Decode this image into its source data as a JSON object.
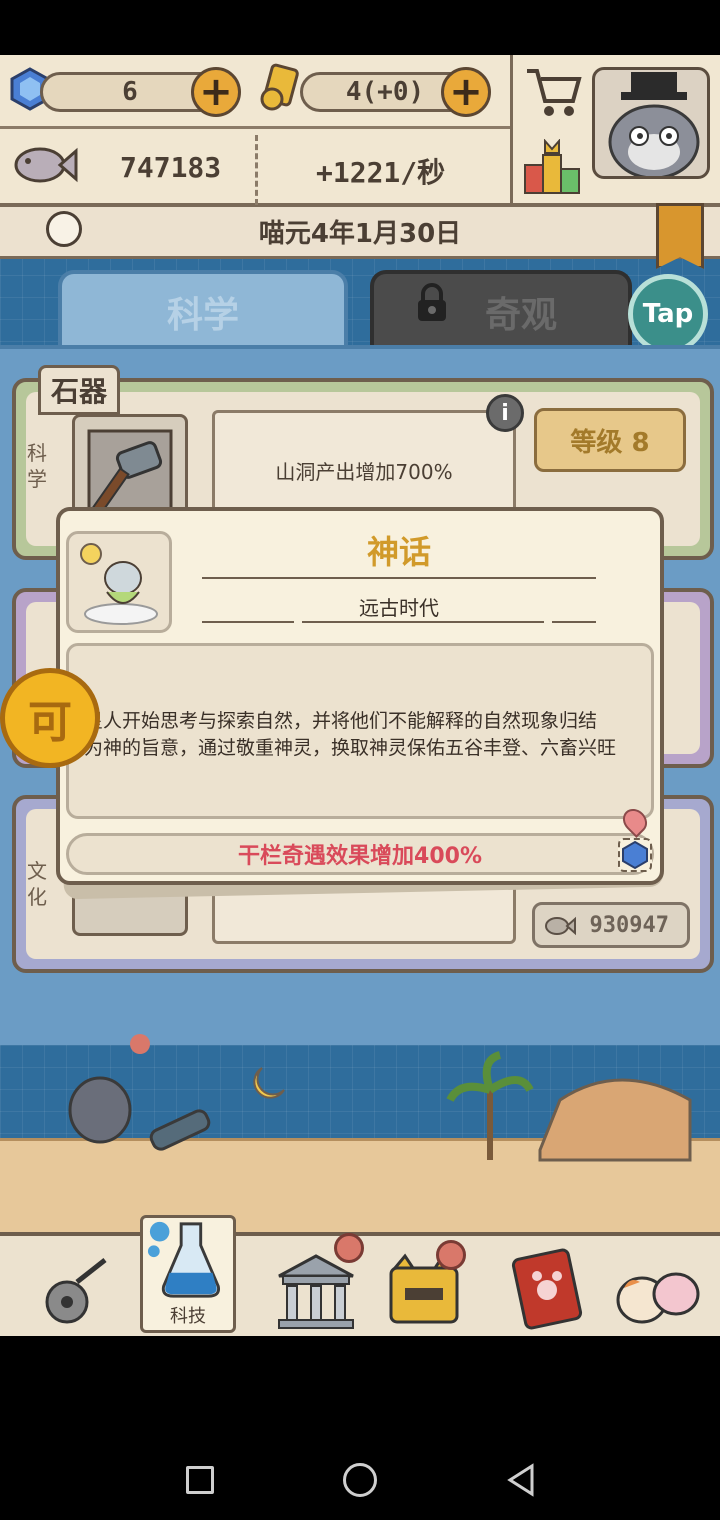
{
  "resources": {
    "gems": "6",
    "scrolls": "4(+0)",
    "fish": "747183",
    "fish_rate": "+1221/秒"
  },
  "date": "喵元4年1月30日",
  "tabs": {
    "science": "科学",
    "wonder": "奇观",
    "tap": "Tap"
  },
  "cards": {
    "stone_age": {
      "label": "石器",
      "side_label": "科学",
      "effect": "山洞产出增加700%",
      "level": "等级 8"
    },
    "culture": {
      "side_label": "文化",
      "effect": "干栏奇遇效果增加400%",
      "cost": "930947"
    }
  },
  "popup": {
    "title": "神话",
    "era": "远古时代",
    "description_line1": "星人开始思考与探索自然，并将他们不能解释的自然现象归结",
    "description_line2": "为神的旨意，通过敬重神灵，换取神灵保佑五谷丰登、六畜兴旺",
    "effect": "干栏奇遇效果增加400%"
  },
  "bottom_nav": {
    "tech_label": "科技"
  },
  "colors": {
    "accent_gold": "#d19a2a",
    "effect_red": "#d94a5a",
    "panel_blue": "#6b9cc5"
  }
}
